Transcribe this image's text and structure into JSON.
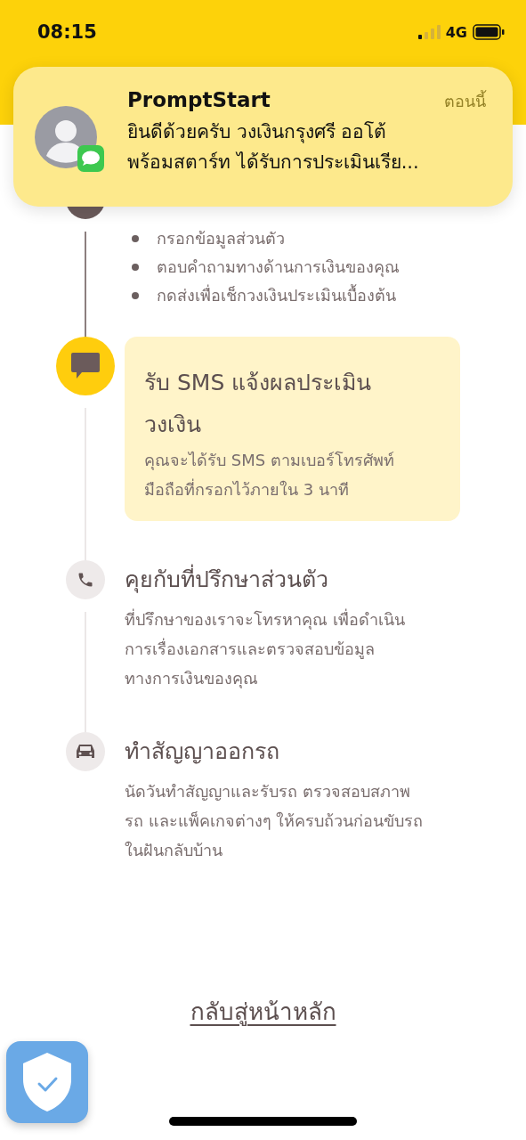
{
  "status_bar": {
    "time": "08:15",
    "network": "4G"
  },
  "notification": {
    "app": "PromptStart",
    "time": "ตอนนี้",
    "message_lines": [
      "ยินดีด้วยครับ วงเงินกรุงศรี ออโต้",
      "พร้อมสตาร์ท ได้รับการประเมินเรีย..."
    ]
  },
  "steps": [
    {
      "completed": true,
      "active": false,
      "bullets": [
        "กรอกข้อมูลส่วนตัว",
        "ตอบคำถามทางด้านการเงินของคุณ",
        "กดส่งเพื่อเช็กวงเงินประเมินเบื้องต้น"
      ]
    },
    {
      "completed": false,
      "active": true,
      "title_lines": [
        "รับ SMS แจ้งผลประเมิน",
        "วงเงิน"
      ],
      "description_lines": [
        "คุณจะได้รับ SMS ตามเบอร์โทรศัพท์",
        "มือถือที่กรอกไว้ภายใน 3 นาที"
      ]
    },
    {
      "completed": false,
      "active": false,
      "title_lines": [
        "คุยกับที่ปรึกษาส่วนตัว"
      ],
      "description_lines": [
        "ที่ปรึกษาของเราจะโทรหาคุณ เพื่อดำเนิน",
        "การเรื่องเอกสารและตรวจสอบข้อมูล",
        "ทางการเงินของคุณ"
      ]
    },
    {
      "completed": false,
      "active": false,
      "title_lines": [
        "ทำสัญญาออกรถ"
      ],
      "description_lines": [
        "นัดวันทำสัญญาและรับรถ ตรวจสอบสภาพ",
        "รถ และแพ็คเกจต่างๆ ให้ครบถ้วนก่อนขับรถ",
        "ในฝันกลับบ้าน"
      ]
    }
  ],
  "home_link": "กลับสู่หน้าหลัก"
}
